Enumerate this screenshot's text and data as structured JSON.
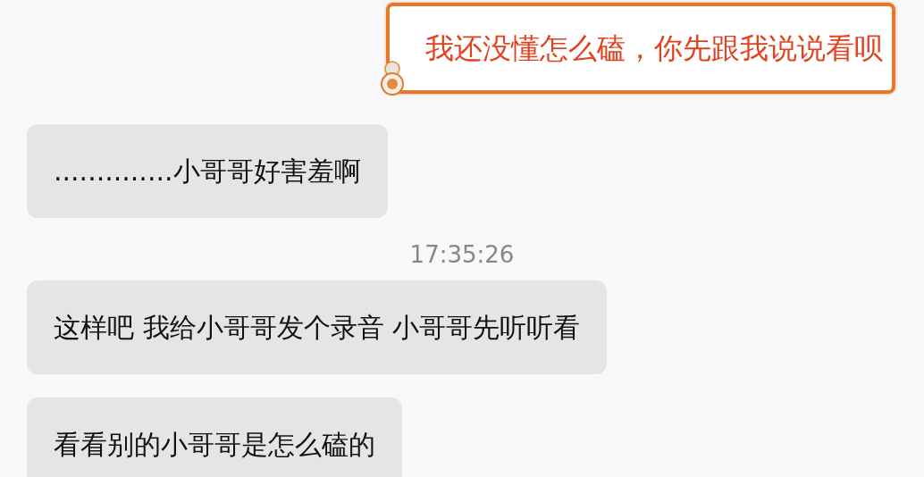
{
  "messages": [
    {
      "kind": "outgoing",
      "text": "我还没懂怎么磕，你先跟我说说看呗"
    },
    {
      "kind": "incoming",
      "text": "..............小哥哥好害羞啊"
    },
    {
      "kind": "time",
      "text": "17:35:26"
    },
    {
      "kind": "incoming",
      "text": "这样吧 我给小哥哥发个录音 小哥哥先听听看"
    },
    {
      "kind": "incoming",
      "text": "看看别的小哥哥是怎么磕的"
    }
  ]
}
